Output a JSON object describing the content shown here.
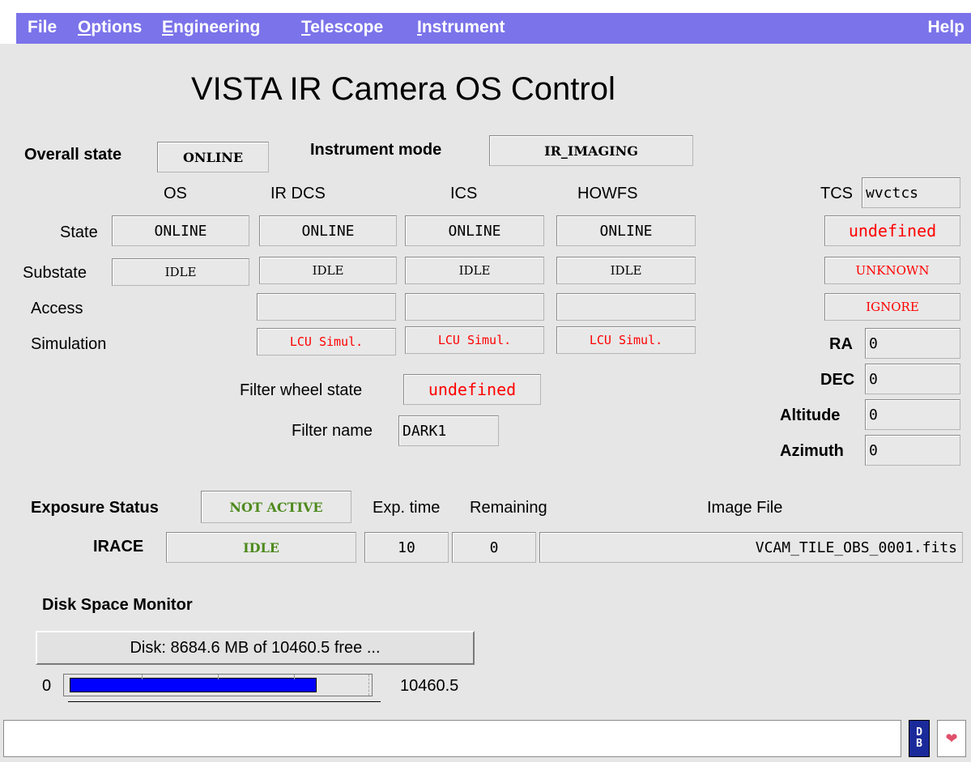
{
  "menubar": {
    "file": "File",
    "options": "Options",
    "engineering": "Engineering",
    "telescope": "Telescope",
    "instrument": "Instrument",
    "help": "Help",
    "color": "#7b73ea"
  },
  "title": "VISTA IR Camera OS Control",
  "overall": {
    "label": "Overall state",
    "value": "ONLINE"
  },
  "instrument_mode": {
    "label": "Instrument mode",
    "value": "IR_IMAGING"
  },
  "columns": {
    "os": "OS",
    "irdcs": "IR DCS",
    "ics": "ICS",
    "howfs": "HOWFS"
  },
  "tcs": {
    "label": "TCS",
    "value": "wvctcs"
  },
  "rows": {
    "state": "State",
    "substate": "Substate",
    "access": "Access",
    "simulation": "Simulation"
  },
  "state": {
    "os": "ONLINE",
    "irdcs": "ONLINE",
    "ics": "ONLINE",
    "howfs": "ONLINE",
    "tcs": "undefined"
  },
  "substate": {
    "os": "IDLE",
    "irdcs": "IDLE",
    "ics": "IDLE",
    "howfs": "IDLE",
    "tcs": "UNKNOWN"
  },
  "access": {
    "irdcs": "",
    "ics": "",
    "howfs": "",
    "tcs": "IGNORE"
  },
  "simulation": {
    "irdcs": "LCU Simul.",
    "ics": "LCU Simul.",
    "howfs": "LCU Simul."
  },
  "filter": {
    "wheel_label": "Filter wheel state",
    "wheel_value": "undefined",
    "name_label": "Filter name",
    "name_value": "DARK1"
  },
  "coords": {
    "ra_label": "RA",
    "ra": "0",
    "dec_label": "DEC",
    "dec": "0",
    "alt_label": "Altitude",
    "alt": "0",
    "az_label": "Azimuth",
    "az": "0"
  },
  "exposure": {
    "label": "Exposure Status",
    "value": "NOT ACTIVE",
    "exp_time_label": "Exp. time",
    "remaining_label": "Remaining",
    "image_file_label": "Image File",
    "irace_label": "IRACE",
    "irace_state": "IDLE",
    "exp_time": "10",
    "remaining": "0",
    "image_file": "VCAM_TILE_OBS_0001.fits"
  },
  "disk": {
    "title": "Disk Space Monitor",
    "button": "Disk: 8684.6 MB of 10460.5 free ...",
    "min": "0",
    "max": "10460.5",
    "free_fraction": 0.83,
    "bar_color": "#0000ff"
  },
  "statusbar": {
    "db_icon": "db-icon",
    "heart_icon": "heart-icon"
  }
}
